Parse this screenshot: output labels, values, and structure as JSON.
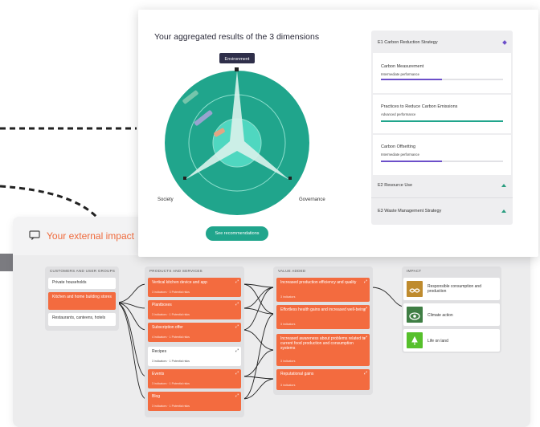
{
  "impact": {
    "title": "Your external impact",
    "columns": {
      "customers": "Customers and user groups",
      "products": "Products and services",
      "value": "Value added",
      "impact": "Impact"
    },
    "customers": [
      "Private households",
      "Kitchen and home building stores",
      "Restaurants, canteens, hotels"
    ],
    "products": [
      {
        "name": "Vertical kitchen device and app",
        "meta": "3 indicators  ·  3 Potential risks"
      },
      {
        "name": "Plantboxes",
        "meta": "3 indicators  ·  1 Potential risks"
      },
      {
        "name": "Subscription offer",
        "meta": "4 indicators  ·  1 Potential risks"
      },
      {
        "name": "Recipes",
        "meta": "3 indicators  ·  1 Potential risks"
      },
      {
        "name": "Events",
        "meta": "3 indicators  ·  1 Potential risks"
      },
      {
        "name": "Blog",
        "meta": "3 indicators  ·  1 Potential risks"
      }
    ],
    "value": [
      {
        "name": "Increased production efficiency and quality",
        "meta": "3 indicators"
      },
      {
        "name": "Effortless health gains and increased well-being",
        "meta": "3 indicators"
      },
      {
        "name": "Increased awareness about problems related to current food production and consumption systems",
        "meta": "3 indicators"
      },
      {
        "name": "Reputational gains",
        "meta": "3 indicators"
      }
    ],
    "sdgs": [
      "Responsible consumption and production",
      "Climate action",
      "Life on land"
    ]
  },
  "results": {
    "title": "Your aggregated results of the 3 dimensions",
    "axes": {
      "environment": "Environment",
      "society": "Society",
      "governance": "Governance"
    },
    "button": "See recommendations",
    "strategies": [
      {
        "code": "E1 Carbon Reduction Strategy"
      },
      {
        "code": "E2 Resource Use"
      },
      {
        "code": "E3 Waste Management Strategy"
      }
    ],
    "items": [
      {
        "name": "Carbon Measurement",
        "level": "Intermediate performance",
        "value": 0.5
      },
      {
        "name": "Practices to Reduce Carbon Emissions",
        "level": "Advanced performance",
        "value": 1.0
      },
      {
        "name": "Carbon Offsetting",
        "level": "Intermediate performance",
        "value": 0.5
      }
    ]
  },
  "colors": {
    "orange": "#f36b3f",
    "teal": "#20a58c",
    "purple": "#6c4fc9",
    "navy": "#2f2f4a"
  }
}
